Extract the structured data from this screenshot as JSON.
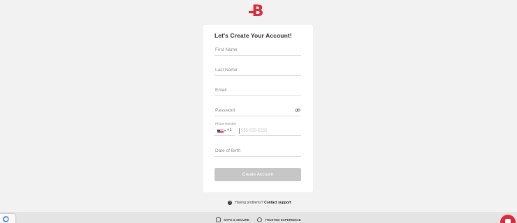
{
  "brand": {
    "logo_letter": "B",
    "accent": "#e0283a"
  },
  "form": {
    "title": "Let's Create Your Account!",
    "first_name_placeholder": "First Name",
    "last_name_placeholder": "Last Name",
    "email_placeholder": "Email",
    "password_placeholder": "Password",
    "phone_label": "Phone Number",
    "phone_dial_code": "+1",
    "phone_country_caret": "▾",
    "phone_placeholder": "555-555-5555",
    "dob_placeholder": "Date of Birth",
    "submit_label": "Create Account"
  },
  "help": {
    "icon": "question-icon",
    "text": "Having problems?",
    "link": "Contact support"
  },
  "footer": {
    "badges": [
      {
        "icon": "lock-icon",
        "label": "SAFE & SECURE"
      },
      {
        "icon": "shield-check-icon",
        "label": "TRUSTED EXPERIENCE"
      }
    ]
  }
}
